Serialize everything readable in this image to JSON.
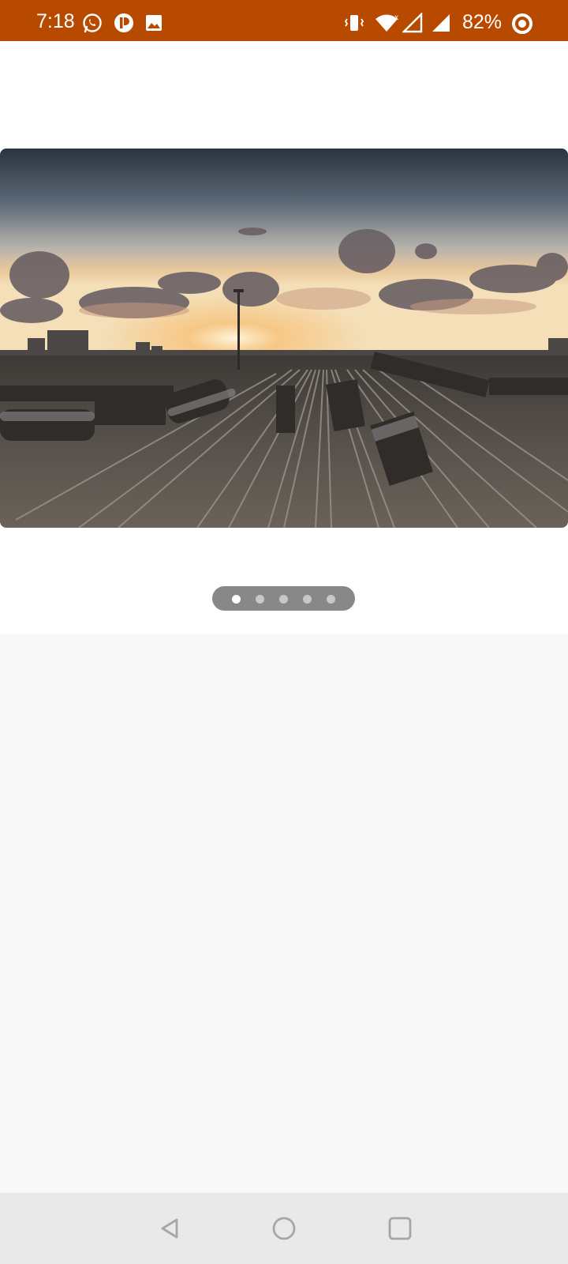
{
  "status_bar": {
    "time": "7:18",
    "battery_percent": "82%",
    "background_color": "#b84a00",
    "left_icons": [
      "whatsapp-icon",
      "app-notification-icon",
      "gallery-icon"
    ],
    "right_icons": [
      "vibrate-icon",
      "wifi-icon",
      "signal-icon",
      "signal-icon",
      "battery-icon"
    ]
  },
  "carousel": {
    "total_slides": 5,
    "active_index": 0,
    "current_image": "railway-yard-sunset-photo"
  },
  "nav_bar": {
    "buttons": [
      "back-icon",
      "home-icon",
      "recents-icon"
    ]
  }
}
